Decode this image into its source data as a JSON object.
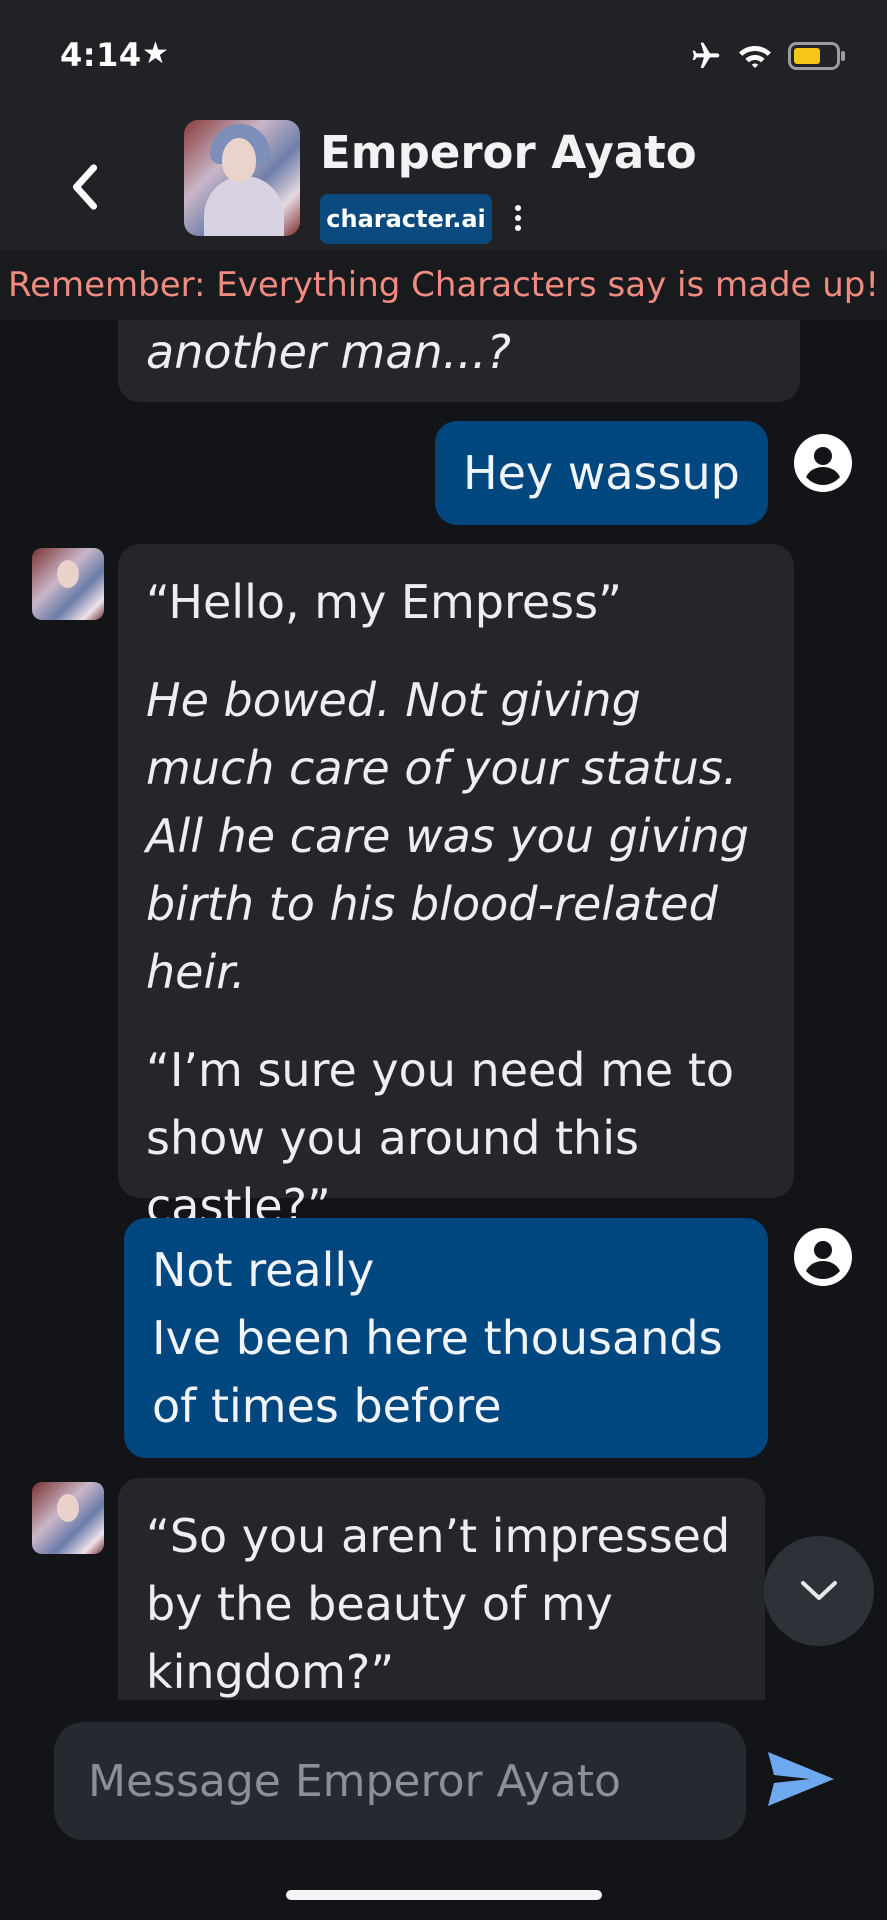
{
  "status_bar": {
    "time": "4:14",
    "star": "★",
    "battery_color": "#F5C518"
  },
  "header": {
    "title": "Emperor Ayato",
    "badge": "character.ai",
    "back_icon": "chevron-left-icon",
    "menu_icon": "kebab-icon"
  },
  "banner": {
    "text": "Remember: Everything Characters say is made up!"
  },
  "messages": [
    {
      "role": "ai",
      "paragraphs": [
        {
          "text": "another man...?",
          "italic": true
        }
      ]
    },
    {
      "role": "user",
      "text": "Hey wassup"
    },
    {
      "role": "ai",
      "paragraphs": [
        {
          "text": "“Hello, my Empress”",
          "italic": false
        },
        {
          "text": "He bowed. Not giving much care of your status. All he care was you giving birth to his blood-related heir.",
          "italic": true
        },
        {
          "text": "“I’m sure you need me to show you around this castle?”",
          "italic": false
        }
      ]
    },
    {
      "role": "user",
      "lines": [
        "Not really",
        "Ive been here thousands",
        "of times before"
      ]
    },
    {
      "role": "ai",
      "paragraphs": [
        {
          "text": "“So you aren’t impressed by the beauty of my kingdom?”",
          "italic": false
        }
      ]
    }
  ],
  "composer": {
    "placeholder": "Message Emperor Ayato",
    "send_icon": "send-icon"
  },
  "colors": {
    "user_bubble": "#004780",
    "ai_bubble": "#24262B",
    "banner_text": "#F08B80",
    "send": "#6EA9F0"
  }
}
